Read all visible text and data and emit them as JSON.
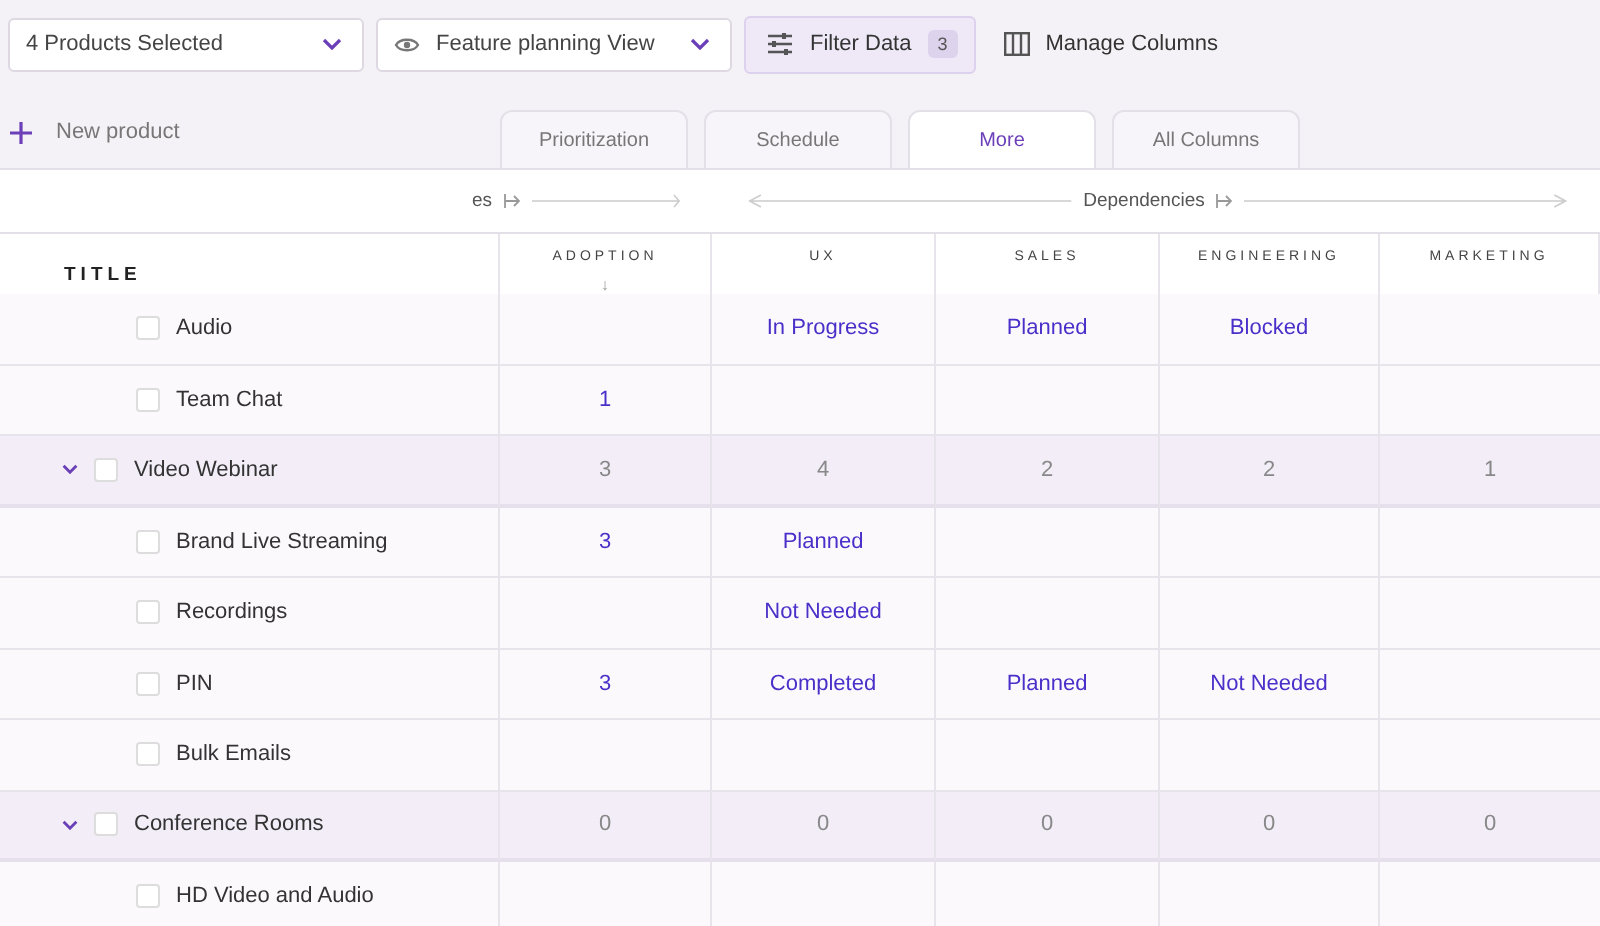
{
  "toolbar": {
    "product_select": {
      "value": "4 Products Selected"
    },
    "view_select": {
      "value": "Feature planning View"
    },
    "filter_button": {
      "label": "Filter Data",
      "count": "3"
    },
    "columns_button": {
      "label": "Manage Columns"
    }
  },
  "new_product": {
    "label": "New product"
  },
  "tabs": [
    {
      "label": "Prioritization",
      "selected": false
    },
    {
      "label": "Schedule",
      "selected": false
    },
    {
      "label": "More",
      "selected": true
    },
    {
      "label": "All Columns",
      "selected": false
    }
  ],
  "column_groups": [
    {
      "label": "es",
      "kind": "right"
    },
    {
      "label": "Dependencies",
      "kind": "both"
    }
  ],
  "table": {
    "columns": [
      {
        "label": "TITLE"
      },
      {
        "label": "ADOPTION",
        "sort_indicator": "↓"
      },
      {
        "label": "UX"
      },
      {
        "label": "SALES"
      },
      {
        "label": "ENGINEERING"
      },
      {
        "label": "MARKETING"
      }
    ],
    "rows": [
      {
        "kind": "item",
        "checked": false,
        "cells": [
          "Audio",
          "",
          "In Progress",
          "Planned",
          "Blocked",
          ""
        ]
      },
      {
        "kind": "item",
        "checked": false,
        "cells": [
          "Team Chat",
          "1",
          "",
          "",
          "",
          ""
        ]
      },
      {
        "kind": "group",
        "checked": false,
        "expanded": true,
        "cells": [
          "Video Webinar",
          "3",
          "4",
          "2",
          "2",
          "1"
        ]
      },
      {
        "kind": "item",
        "checked": false,
        "cells": [
          "Brand Live Streaming",
          "3",
          "Planned",
          "",
          "",
          ""
        ]
      },
      {
        "kind": "item",
        "checked": false,
        "cells": [
          "Recordings",
          "",
          "Not Needed",
          "",
          "",
          ""
        ]
      },
      {
        "kind": "item",
        "checked": false,
        "cells": [
          "PIN",
          "3",
          "Completed",
          "Planned",
          "Not Needed",
          ""
        ]
      },
      {
        "kind": "item",
        "checked": false,
        "cells": [
          "Bulk Emails",
          "",
          "",
          "",
          "",
          ""
        ]
      },
      {
        "kind": "group",
        "checked": false,
        "expanded": true,
        "cells": [
          "Conference Rooms",
          "0",
          "0",
          "0",
          "0",
          "0"
        ]
      },
      {
        "kind": "item",
        "checked": false,
        "cells": [
          "HD Video and Audio",
          "",
          "",
          "",
          "",
          ""
        ]
      }
    ]
  }
}
